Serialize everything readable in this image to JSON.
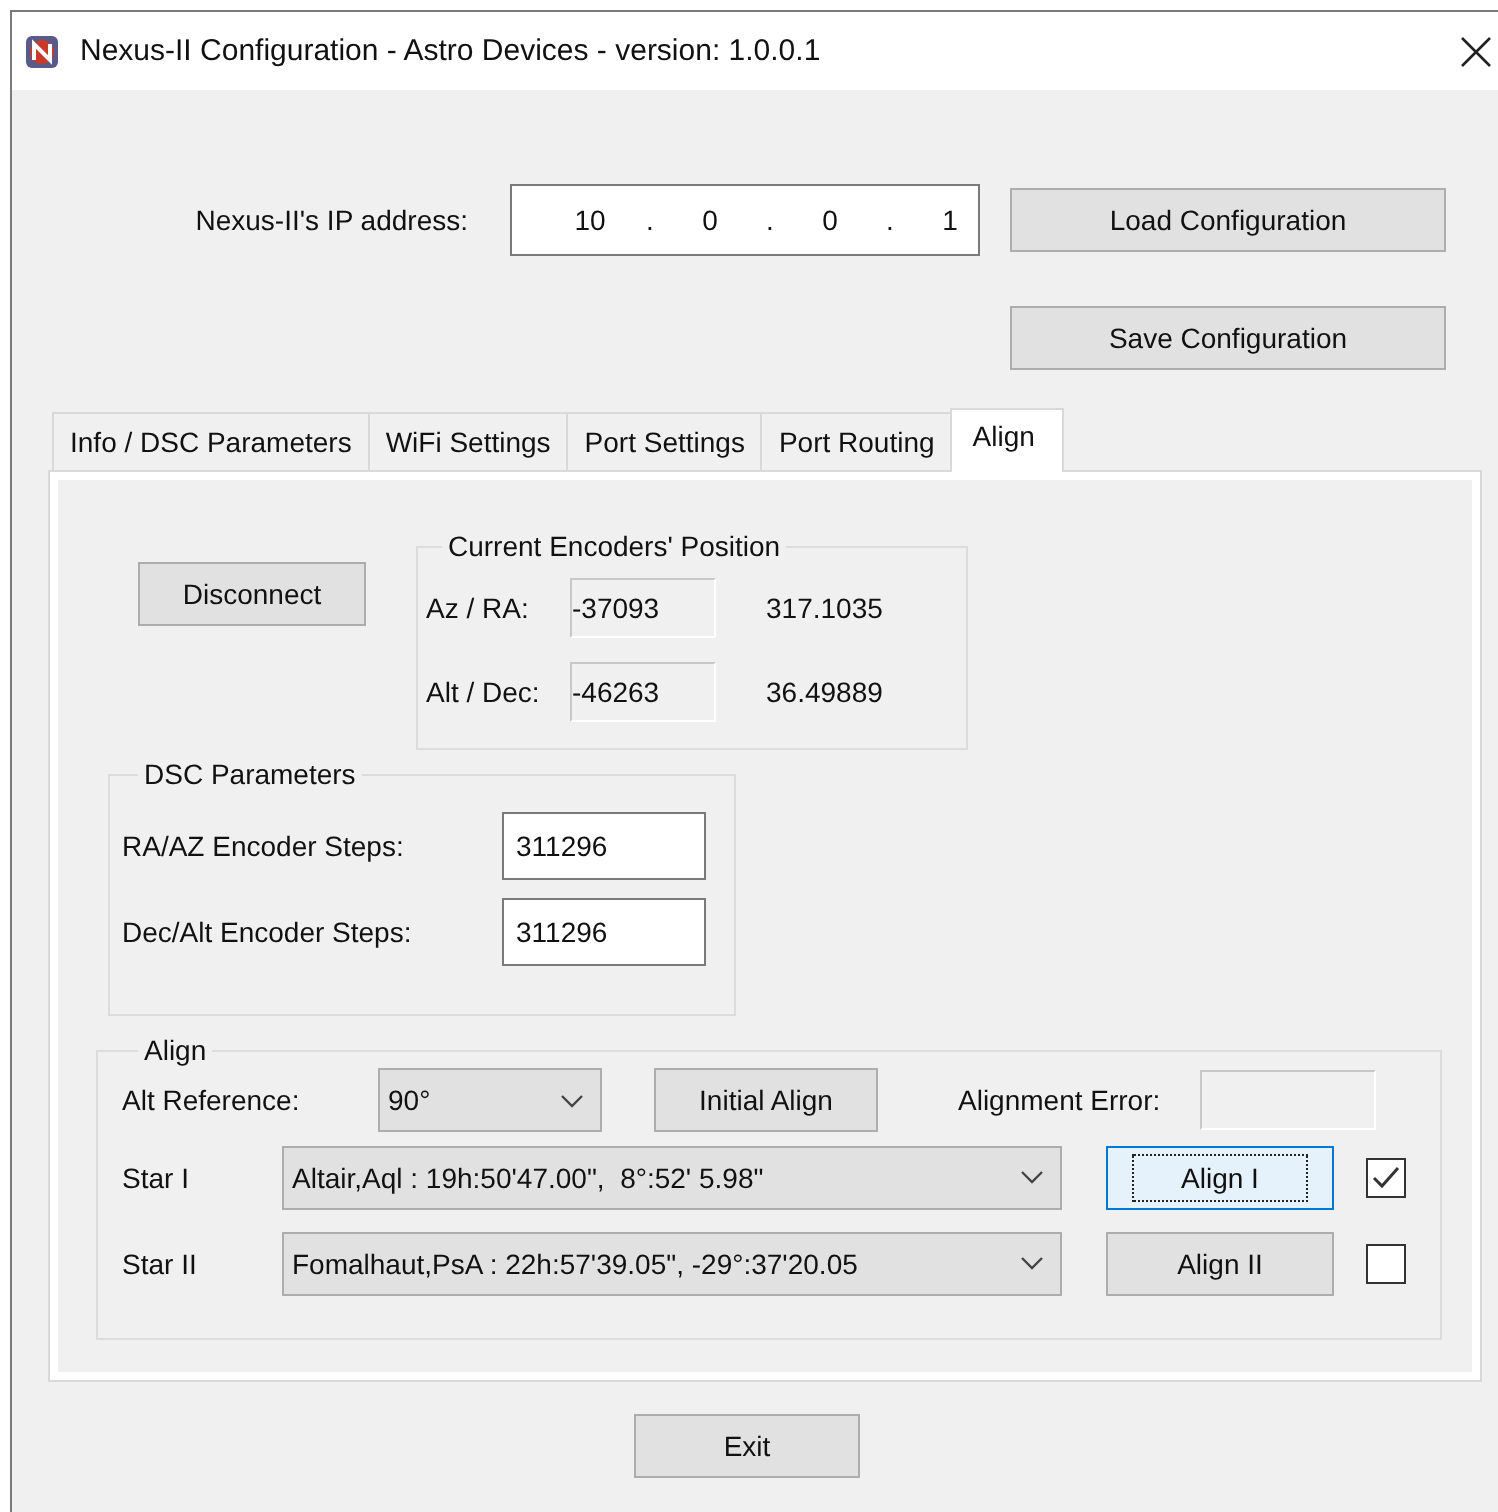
{
  "window": {
    "title": "Nexus-II Configuration - Astro Devices - version: 1.0.0.1"
  },
  "ip": {
    "label": "Nexus-II's IP address:",
    "octets": [
      "10",
      "0",
      "0",
      "1"
    ],
    "separator": "."
  },
  "config_buttons": [
    "Load Configuration",
    "Save Configuration"
  ],
  "tabs": [
    {
      "label": "Info / DSC Parameters",
      "selected": false
    },
    {
      "label": "WiFi Settings",
      "selected": false
    },
    {
      "label": "Port Settings",
      "selected": false
    },
    {
      "label": "Port Routing",
      "selected": false
    },
    {
      "label": "Align",
      "selected": true
    }
  ],
  "disconnect_button": "Disconnect",
  "encoders": {
    "title": "Current Encoders' Position",
    "rows": [
      {
        "label": "Az / RA:",
        "steps": "-37093",
        "degrees": "317.1035"
      },
      {
        "label": "Alt / Dec:",
        "steps": "-46263",
        "degrees": "36.49889"
      }
    ]
  },
  "dsc_parameters": {
    "title": "DSC Parameters",
    "rows": [
      {
        "label": "RA/AZ Encoder Steps:",
        "value": "311296"
      },
      {
        "label": "Dec/Alt Encoder Steps:",
        "value": "311296"
      }
    ]
  },
  "align": {
    "title": "Align",
    "alt_reference_label": "Alt Reference:",
    "alt_reference_value": "90°",
    "initial_align_button": "Initial Align",
    "alignment_error_label": "Alignment Error:",
    "stars": [
      {
        "label": "Star I",
        "value": "Altair,Aql : 19h:50'47.00\",  8°:52' 5.98\"",
        "button": "Align I",
        "focused": true,
        "checked": true
      },
      {
        "label": "Star II",
        "value": "Fomalhaut,PsA : 22h:57'39.05\", -29°:37'20.05",
        "button": "Align II",
        "focused": false,
        "checked": false
      }
    ]
  },
  "exit_button": "Exit"
}
